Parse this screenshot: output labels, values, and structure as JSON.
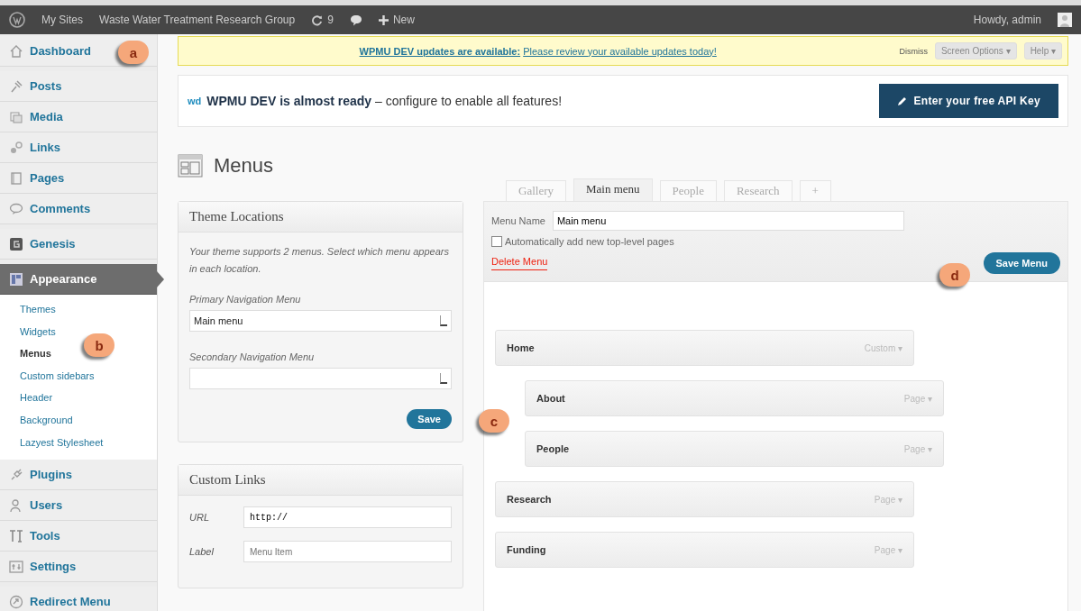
{
  "admin_bar": {
    "items": [
      {
        "kind": "logo"
      },
      {
        "kind": "text",
        "label": "My Sites"
      },
      {
        "kind": "text",
        "label": "Waste Water Treatment Research Group"
      },
      {
        "kind": "updates",
        "label": "9"
      },
      {
        "kind": "comments"
      },
      {
        "kind": "new",
        "label": "New"
      }
    ],
    "greeting": "Howdy, admin"
  },
  "sidebar": {
    "groups": [
      {
        "items": [
          {
            "label": "Dashboard",
            "selected": false
          }
        ]
      },
      {
        "items": [
          {
            "label": "Posts",
            "selected": false
          },
          {
            "label": "Media",
            "selected": false
          },
          {
            "label": "Links",
            "selected": false
          },
          {
            "label": "Pages",
            "selected": false
          },
          {
            "label": "Comments",
            "selected": false
          }
        ]
      },
      {
        "items": [
          {
            "label": "Genesis",
            "selected": false
          }
        ]
      },
      {
        "items": [
          {
            "label": "Appearance",
            "selected": true,
            "children": [
              {
                "label": "Themes",
                "selected": false
              },
              {
                "label": "Widgets",
                "selected": false
              },
              {
                "label": "Menus",
                "selected": true
              },
              {
                "label": "Custom sidebars",
                "selected": false
              },
              {
                "label": "Header",
                "selected": false
              },
              {
                "label": "Background",
                "selected": false
              },
              {
                "label": "Lazyest Stylesheet",
                "selected": false
              }
            ]
          },
          {
            "label": "Plugins",
            "selected": false
          },
          {
            "label": "Users",
            "selected": false
          },
          {
            "label": "Tools",
            "selected": false
          },
          {
            "label": "Settings",
            "selected": false
          }
        ]
      },
      {
        "items": [
          {
            "label": "Redirect Menu",
            "selected": false
          }
        ]
      }
    ]
  },
  "notice": {
    "link": "WPMU DEV updates are available:",
    "text": "Please review your available updates today!",
    "dismiss": "Dismiss"
  },
  "screen_options": [
    "Screen Options ▾",
    "Help ▾"
  ],
  "wpmu_banner": {
    "logo": "wd",
    "title": "WPMU DEV is almost ready",
    "text": " – configure to enable all features!",
    "button": "Enter your free API Key"
  },
  "page_title": "Menus",
  "theme_locations": {
    "title": "Theme Locations",
    "description": "Your theme supports 2 menus. Select which menu appears in each location.",
    "locations": [
      {
        "label": "Primary Navigation Menu",
        "value": "Main menu"
      },
      {
        "label": "Secondary Navigation Menu"
      }
    ],
    "button": "Save"
  },
  "custom_links": {
    "title": "Custom Links",
    "url_label": "URL",
    "url_value": "http://",
    "label_label": "Label",
    "label_placeholder": "Menu Item"
  },
  "menu_tabs": [
    {
      "label": "Gallery",
      "selected": false
    },
    {
      "label": "Main menu",
      "selected": true
    },
    {
      "label": "People",
      "selected": false
    },
    {
      "label": "Research",
      "selected": false
    },
    {
      "label": "+",
      "selected": false
    }
  ],
  "menu_editor": {
    "name_label": "Menu Name",
    "name_value": "Main menu",
    "auto_add_label": "Automatically add new top-level pages",
    "auto_add_checked": false,
    "delete": "Delete Menu",
    "save": "Save Menu",
    "items": [
      {
        "title": "Home",
        "type": "Custom ▾",
        "children": [
          {
            "title": "About",
            "type": "Page ▾"
          },
          {
            "title": "People",
            "type": "Page ▾"
          }
        ]
      },
      {
        "title": "Research",
        "type": "Page ▾"
      },
      {
        "title": "Funding",
        "type": "Page ▾"
      }
    ]
  },
  "callouts": [
    "a",
    "b",
    "c",
    "d"
  ]
}
